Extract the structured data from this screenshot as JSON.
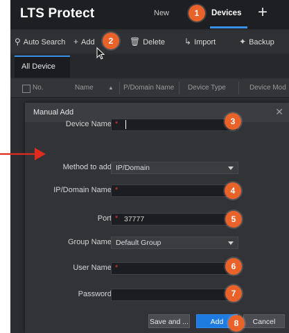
{
  "app": {
    "title": "LTS Protect"
  },
  "tabs": {
    "new_label": "New",
    "devices_label": "Devices",
    "add_tab_icon": "plus-icon"
  },
  "toolbar": {
    "auto_search": "Auto Search",
    "add": "Add",
    "delete": "Delete",
    "import": "Import",
    "backup": "Backup"
  },
  "device_tabs": {
    "all_device": "All Device"
  },
  "table": {
    "columns": [
      "No.",
      "Name",
      "P/Domain Name",
      "Device Type",
      "Device Mod"
    ]
  },
  "dialog": {
    "title": "Manual Add",
    "fields": {
      "device_name": {
        "label": "Device Name:",
        "value": ""
      },
      "method": {
        "label": "Method to add:",
        "value": "IP/Domain"
      },
      "ip_domain": {
        "label": "IP/Domain Name:",
        "value": ""
      },
      "port": {
        "label": "Port:",
        "value": "37777"
      },
      "group": {
        "label": "Group Name:",
        "value": "Default Group"
      },
      "user": {
        "label": "User Name:",
        "value": ""
      },
      "password": {
        "label": "Password:",
        "value": ""
      }
    },
    "buttons": {
      "save_and": "Save and ...",
      "add": "Add",
      "cancel": "Cancel"
    }
  },
  "badges": [
    "1",
    "2",
    "3",
    "4",
    "5",
    "6",
    "7",
    "8"
  ],
  "colors": {
    "accent": "#3a8fe8",
    "badge": "#e8622a",
    "required": "#e0363b",
    "pointer": "#e02b1f"
  }
}
